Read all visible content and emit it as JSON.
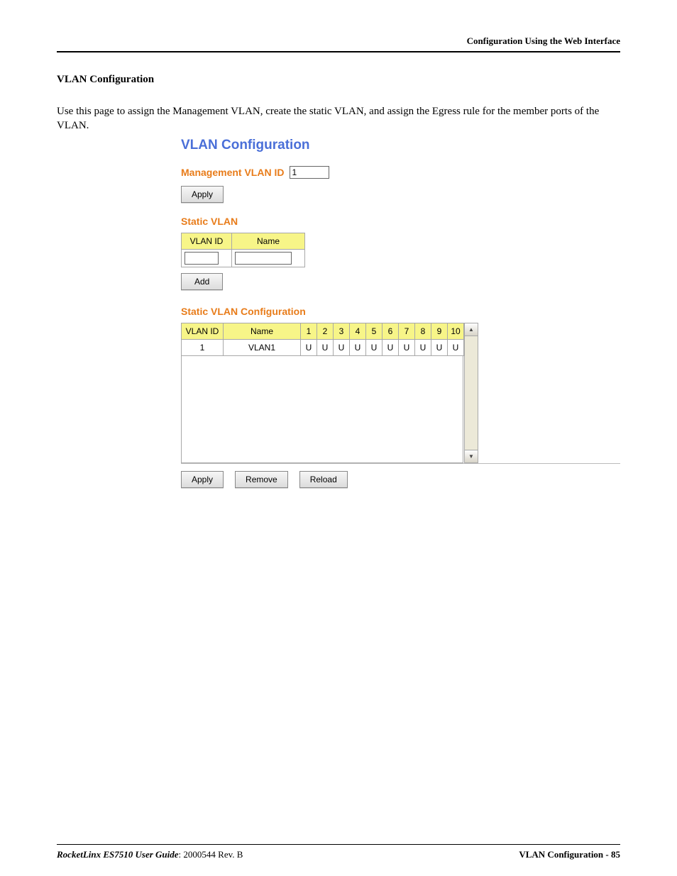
{
  "header": {
    "right": "Configuration Using the Web Interface"
  },
  "doc": {
    "section_title": "VLAN Configuration",
    "intro": "Use this page to assign the Management VLAN, create the static VLAN, and assign the Egress rule for the member ports of the VLAN."
  },
  "ui": {
    "title": "VLAN Configuration",
    "management": {
      "label": "Management VLAN ID",
      "value": "1",
      "apply": "Apply"
    },
    "static_vlan": {
      "title": "Static VLAN",
      "col_vlanid": "VLAN ID",
      "col_name": "Name",
      "vlanid_value": "",
      "name_value": "",
      "add": "Add"
    },
    "static_cfg": {
      "title": "Static VLAN Configuration",
      "col_vlanid": "VLAN ID",
      "col_name": "Name",
      "ports": [
        "1",
        "2",
        "3",
        "4",
        "5",
        "6",
        "7",
        "8",
        "9",
        "10"
      ],
      "rows": [
        {
          "vlanid": "1",
          "name": "VLAN1",
          "ports": [
            "U",
            "U",
            "U",
            "U",
            "U",
            "U",
            "U",
            "U",
            "U",
            "U"
          ]
        }
      ],
      "apply": "Apply",
      "remove": "Remove",
      "reload": "Reload"
    }
  },
  "footer": {
    "product": "RocketLinx ES7510  User Guide",
    "rev": ": 2000544 Rev. B",
    "right": "VLAN Configuration - 85"
  }
}
